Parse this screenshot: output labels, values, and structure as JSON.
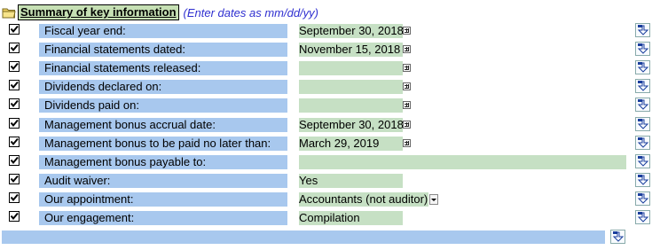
{
  "section": {
    "title": "Summary of key information",
    "hint": "(Enter dates as mm/dd/yy)"
  },
  "rows": [
    {
      "label": "Fiscal year end:",
      "value": "September 30, 2018",
      "control": "calendar",
      "checked": true
    },
    {
      "label": "Financial statements dated:",
      "value": "November 15, 2018",
      "control": "calendar",
      "checked": true
    },
    {
      "label": "Financial statements released:",
      "value": "",
      "control": "calendar",
      "checked": true
    },
    {
      "label": "Dividends declared on:",
      "value": "",
      "control": "calendar",
      "checked": true
    },
    {
      "label": "Dividends paid on:",
      "value": "",
      "control": "calendar",
      "checked": true
    },
    {
      "label": "Management bonus accrual date:",
      "value": "September 30, 2018",
      "control": "calendar",
      "checked": true
    },
    {
      "label": "Management bonus to be paid no later than:",
      "value": "March 29, 2019",
      "control": "calendar",
      "checked": true
    },
    {
      "label": "Management bonus payable to:",
      "value": "",
      "control": "text-wide",
      "checked": true
    },
    {
      "label": "Audit waiver:",
      "value": "Yes",
      "control": "none",
      "checked": true
    },
    {
      "label": "Our appointment:",
      "value": "Accountants (not auditor)",
      "control": "dropdown",
      "checked": true
    },
    {
      "label": "Our engagement:",
      "value": "Compilation",
      "control": "none",
      "checked": true
    }
  ],
  "icons": {
    "checkbox": "checkbox-checked-icon",
    "calendar": "calendar-icon",
    "insert": "insert-row-icon",
    "folder": "folder-icon"
  },
  "colors": {
    "label_bg": "#a8c8ee",
    "value_bg": "#c6e0c4",
    "hint": "#2f2fd0"
  }
}
